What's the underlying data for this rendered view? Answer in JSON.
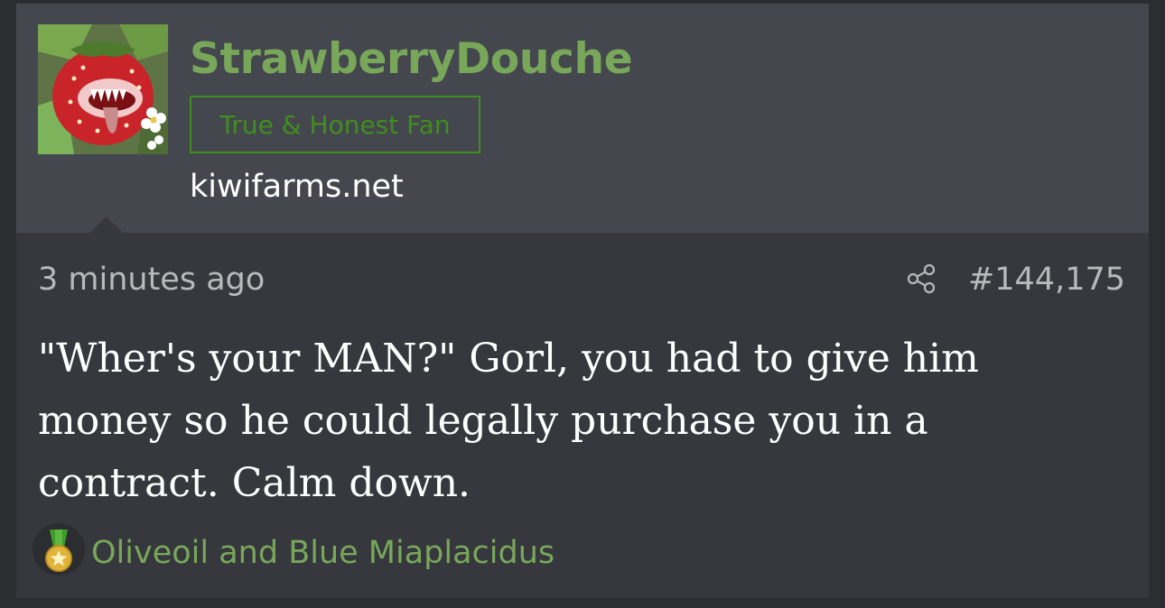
{
  "user": {
    "username": "StrawberryDouche",
    "title": "True & Honest Fan",
    "site": "kiwifarms.net",
    "avatar": "strawberry-monster-avatar"
  },
  "post": {
    "time": "3 minutes ago",
    "number": "#144,175",
    "message": "\"Wher's your MAN?\" Gorl, you had to give him money so he could legally purchase you in a contract. Calm down.",
    "share_icon": "share-icon"
  },
  "reactions": {
    "icon": "medal-icon",
    "text": "Oliveoil and Blue Miaplacidus"
  },
  "colors": {
    "username": "#78a75a",
    "title_border": "#3e8d1f",
    "background": "#36383d",
    "user_block": "#45474e"
  }
}
